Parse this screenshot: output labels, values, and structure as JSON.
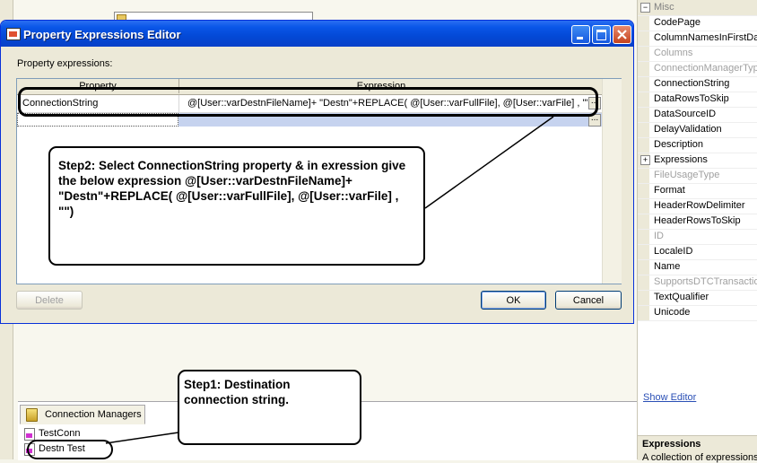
{
  "dialog": {
    "title": "Property Expressions Editor",
    "property_expressions_label": "Property expressions:",
    "grid": {
      "columns": [
        "Property",
        "Expression"
      ],
      "rows": [
        {
          "property": "ConnectionString",
          "expression": "@[User::varDestnFileName]+ \"Destn\"+REPLACE( @[User::varFullFile], @[User::varFile] , \"\")"
        }
      ],
      "ellipsis_label": "..."
    },
    "buttons": {
      "delete": "Delete",
      "ok": "OK",
      "cancel": "Cancel"
    }
  },
  "annotations": {
    "step2": "Step2: Select ConnectionString property & in exression give the below expression @[User::varDestnFileName]+ \"Destn\"+REPLACE( @[User::varFullFile], @[User::varFile] , \"\")",
    "step1": "Step1: Destination connection string."
  },
  "connection_managers": {
    "tab_label": "Connection Managers",
    "items": [
      "TestConn",
      "Destn Test"
    ]
  },
  "properties": {
    "rows": [
      {
        "name": "Misc",
        "kind": "category",
        "toggle": "−"
      },
      {
        "name": "CodePage",
        "kind": "normal"
      },
      {
        "name": "ColumnNamesInFirstDataRow",
        "kind": "normal"
      },
      {
        "name": "Columns",
        "kind": "disabled"
      },
      {
        "name": "ConnectionManagerType",
        "kind": "disabled"
      },
      {
        "name": "ConnectionString",
        "kind": "normal"
      },
      {
        "name": "DataRowsToSkip",
        "kind": "normal"
      },
      {
        "name": "DataSourceID",
        "kind": "normal"
      },
      {
        "name": "DelayValidation",
        "kind": "normal"
      },
      {
        "name": "Description",
        "kind": "normal"
      },
      {
        "name": "Expressions",
        "kind": "expandable",
        "toggle": "+"
      },
      {
        "name": "FileUsageType",
        "kind": "disabled"
      },
      {
        "name": "Format",
        "kind": "normal"
      },
      {
        "name": "HeaderRowDelimiter",
        "kind": "normal"
      },
      {
        "name": "HeaderRowsToSkip",
        "kind": "normal"
      },
      {
        "name": "ID",
        "kind": "disabled"
      },
      {
        "name": "LocaleID",
        "kind": "normal"
      },
      {
        "name": "Name",
        "kind": "normal"
      },
      {
        "name": "SupportsDTCTransactions",
        "kind": "disabled"
      },
      {
        "name": "TextQualifier",
        "kind": "normal"
      },
      {
        "name": "Unicode",
        "kind": "normal"
      }
    ],
    "show_editor_link": "Show Editor",
    "description_title": "Expressions",
    "description_text": "A collection of expressions"
  }
}
